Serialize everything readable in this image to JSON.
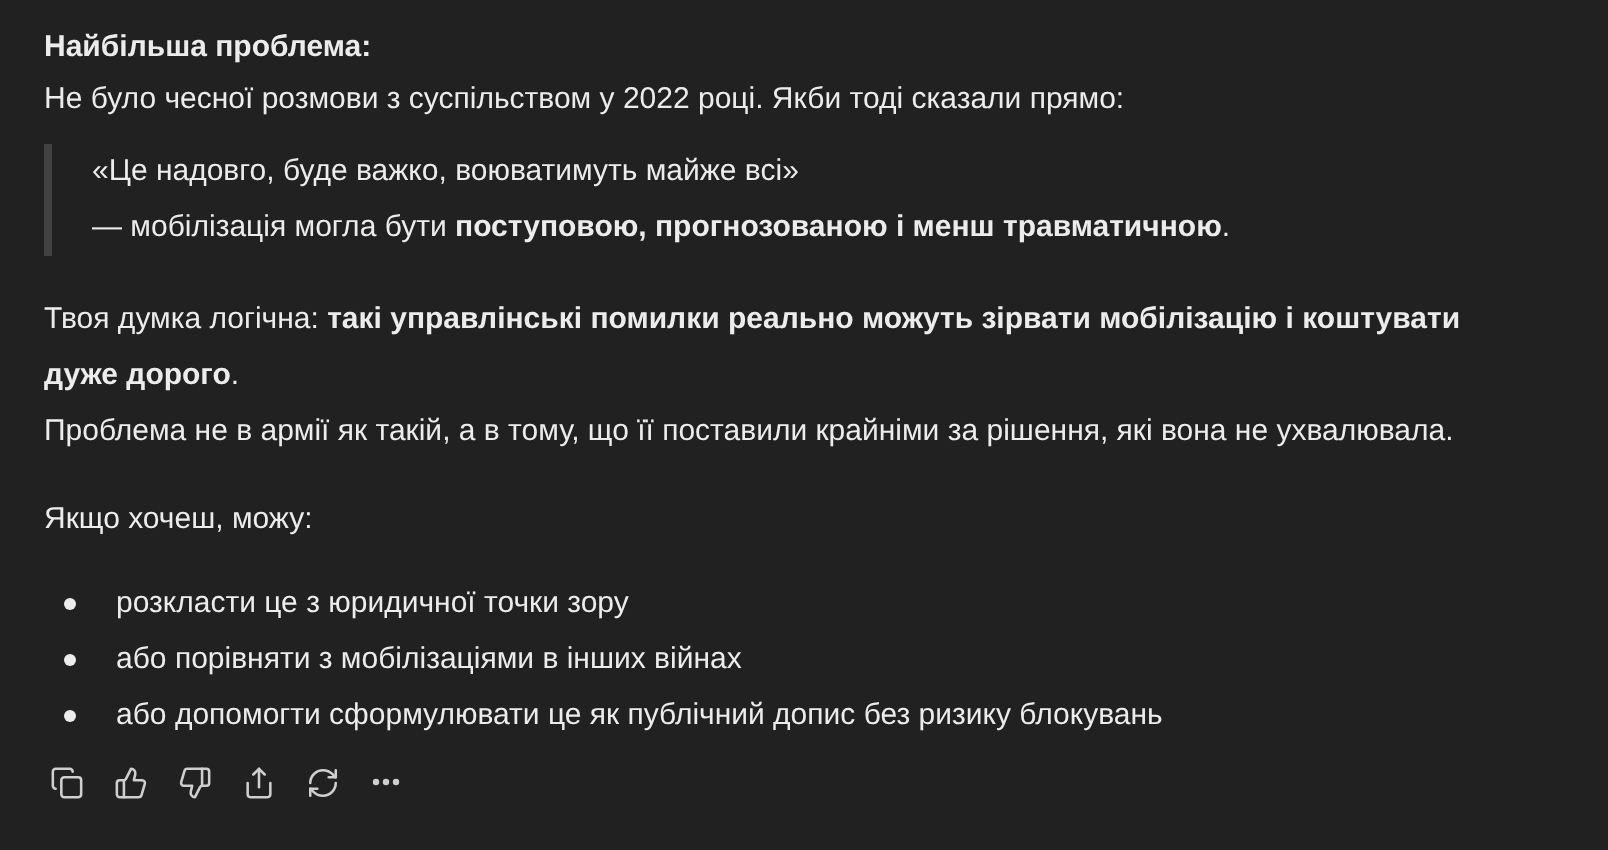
{
  "message": {
    "heading": "Найбільша проблема:",
    "intro": "Не було чесної розмови з суспільством у 2022 році. Якби тоді сказали прямо:",
    "quote": [
      "«Це надовго, буде важко, воюватимуть майже всі»",
      "— мобілізація могла бути **поступовою, прогнозованою і менш травматичною**."
    ],
    "paragraphs": [
      "Твоя думка логічна: **такі управлінські помилки реально можуть зірвати мобілізацію і коштувати дуже дорого**.",
      "Проблема не в армії як такій, а в тому, що її поставили крайніми за рішення, які вона не ухвалювала."
    ],
    "offer": "Якщо хочеш, можу:",
    "bullets": [
      "розкласти це з юридичної точки зору",
      "або порівняти з мобілізаціями в інших війнах",
      "або допомогти сформулювати це як публічний допис без ризику блокувань"
    ]
  },
  "actions": [
    {
      "kind": "copy"
    },
    {
      "kind": "like"
    },
    {
      "kind": "dislike"
    },
    {
      "kind": "share"
    },
    {
      "kind": "regenerate"
    },
    {
      "kind": "more"
    }
  ]
}
